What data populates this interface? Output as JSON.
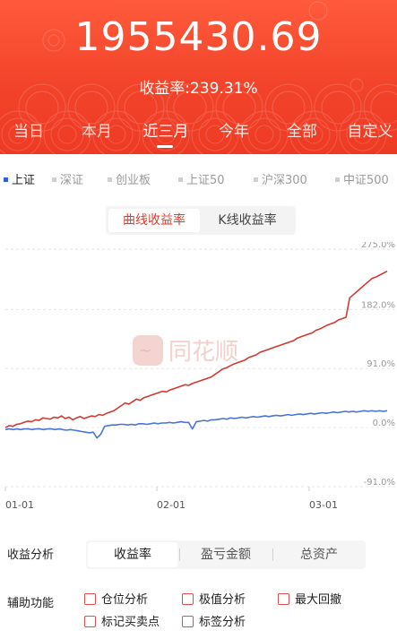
{
  "header": {
    "total_value": "1955430.69",
    "rate_label": "收益率:239.31%"
  },
  "period_tabs": [
    {
      "label": "当日"
    },
    {
      "label": "本月"
    },
    {
      "label": "近三月"
    },
    {
      "label": "今年"
    },
    {
      "label": "全部"
    },
    {
      "label": "自定义"
    }
  ],
  "active_period": "近三月",
  "index_tabs": [
    {
      "label": "上证"
    },
    {
      "label": "深证"
    },
    {
      "label": "创业板"
    },
    {
      "label": "上证50"
    },
    {
      "label": "沪深300"
    },
    {
      "label": "中证500"
    }
  ],
  "active_index": "上证",
  "chart_toggle": {
    "curve": "曲线收益率",
    "kline": "K线收益率"
  },
  "chart_data": {
    "type": "line",
    "y_ticks": [
      "275.0%",
      "182.0%",
      "91.0%",
      "0.0%",
      "-91.0%"
    ],
    "x_ticks": [
      "01-01",
      "02-01",
      "03-01"
    ],
    "ylim": [
      -91,
      275
    ],
    "watermark": "同花顺",
    "series": [
      {
        "color": "#d03a33",
        "values": [
          0,
          3,
          2,
          5,
          6,
          8,
          10,
          9,
          12,
          11,
          15,
          14,
          13,
          16,
          15,
          18,
          14,
          16,
          12,
          15,
          17,
          14,
          16,
          18,
          17,
          20,
          19,
          22,
          24,
          26,
          30,
          34,
          38,
          36,
          40,
          44,
          42,
          46,
          48,
          50,
          52,
          54,
          56,
          55,
          58,
          60,
          62,
          64,
          66,
          65,
          68,
          70,
          72,
          74,
          76,
          78,
          82,
          86,
          90,
          92,
          95,
          98,
          100,
          102,
          104,
          108,
          110,
          112,
          116,
          118,
          120,
          122,
          124,
          126,
          128,
          130,
          132,
          134,
          138,
          140,
          142,
          144,
          146,
          150,
          152,
          155,
          158,
          160,
          162,
          166,
          168,
          170,
          200,
          205,
          210,
          215,
          220,
          225,
          230,
          232,
          235,
          238,
          241
        ]
      },
      {
        "color": "#4a74d8",
        "values": [
          -3,
          -2,
          -3,
          -2,
          -3,
          -2,
          -2,
          -3,
          -2,
          -2,
          -3,
          -2,
          -2,
          -3,
          -2,
          -3,
          -4,
          -3,
          -4,
          -5,
          -6,
          -7,
          -8,
          -7,
          -16,
          -10,
          2,
          3,
          4,
          4,
          5,
          5,
          4,
          5,
          4,
          6,
          6,
          5,
          6,
          7,
          6,
          7,
          7,
          8,
          7,
          8,
          9,
          8,
          8,
          -2,
          9,
          10,
          11,
          10,
          12,
          12,
          13,
          14,
          13,
          15,
          14,
          15,
          16,
          15,
          16,
          17,
          16,
          17,
          18,
          17,
          18,
          19,
          18,
          19,
          20,
          19,
          20,
          21,
          20,
          21,
          22,
          21,
          22,
          23,
          22,
          23,
          24,
          23,
          24,
          25,
          24,
          25,
          24,
          25,
          26,
          25,
          26,
          25,
          26,
          25,
          26
        ]
      }
    ]
  },
  "analysis": {
    "label": "收益分析",
    "tabs": [
      {
        "label": "收益率"
      },
      {
        "label": "盈亏金额"
      },
      {
        "label": "总资产"
      }
    ]
  },
  "aux": {
    "label": "辅助功能",
    "options": [
      {
        "label": "仓位分析"
      },
      {
        "label": "极值分析"
      },
      {
        "label": "最大回撤"
      },
      {
        "label": "标记买卖点"
      },
      {
        "label": "标签分析"
      }
    ]
  }
}
